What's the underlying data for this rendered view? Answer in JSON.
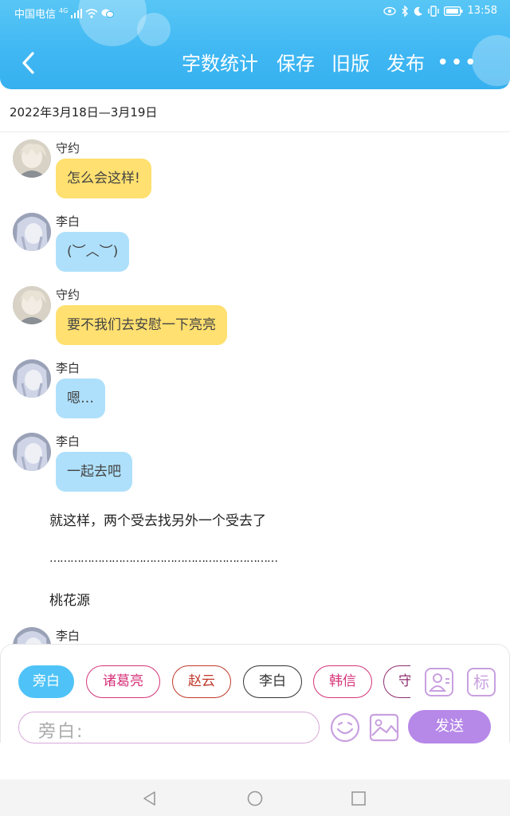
{
  "status_bar": {
    "carrier": "中国电信",
    "network": "4G",
    "time": "13:58"
  },
  "toolbar": {
    "word_count": "字数统计",
    "save": "保存",
    "old_version": "旧版",
    "publish": "发布",
    "more": "•••"
  },
  "date_range": "2022年3月18日—3月19日",
  "messages": [
    {
      "name": "守约",
      "text": "怎么会这样!"
    },
    {
      "name": "李白",
      "text": "(︶︿︶)"
    },
    {
      "name": "守约",
      "text": "要不我们去安慰一下亮亮"
    },
    {
      "name": "李白",
      "text": "嗯…"
    },
    {
      "name": "李白",
      "text": "一起去吧"
    }
  ],
  "narration": [
    "就这样，两个受去找另外一个受去了",
    "…………………………………………………………",
    "桃花源"
  ],
  "partial_message": {
    "name": "李白"
  },
  "roles": [
    "旁白",
    "诸葛亮",
    "赵云",
    "李白",
    "韩信",
    "守"
  ],
  "role_colors": [
    "#4fc3f7",
    "#d6337a",
    "#c0392b",
    "#333333",
    "#d6337a",
    "#8e2c6e"
  ],
  "label_button": "标",
  "input_placeholder": "旁白:",
  "send_label": "发送",
  "colors": {
    "header": "#3fb7f3",
    "bubble_shouyue": "#ffe070",
    "bubble_libai": "#aee0fb",
    "send": "#b688e8"
  }
}
